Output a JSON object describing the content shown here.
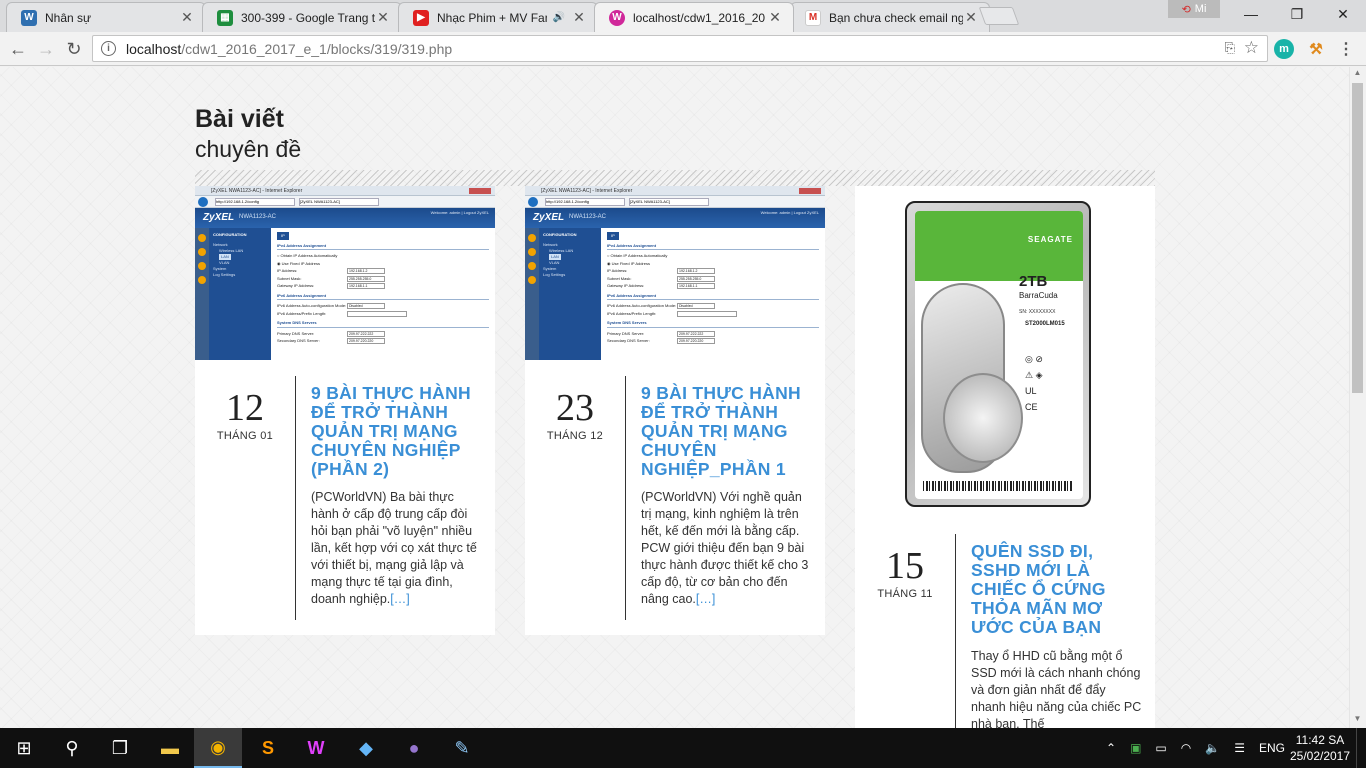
{
  "browser": {
    "tabs": [
      {
        "title": "Nhân sự",
        "favicon_color": "#2f6fb0",
        "favicon_glyph": "W",
        "active": false
      },
      {
        "title": "300-399 - Google Trang t",
        "favicon_color": "#1e8e3e",
        "favicon_glyph": "▦",
        "active": false
      },
      {
        "title": "Nhạc Phim + MV Fan",
        "favicon_color": "#e02020",
        "favicon_glyph": "▶",
        "active": false,
        "audio": true
      },
      {
        "title": "localhost/cdw1_2016_20",
        "favicon_color": "#d0289a",
        "favicon_glyph": "W",
        "active": true
      },
      {
        "title": "Bạn chưa check email ng",
        "favicon_color": "#ffffff",
        "favicon_glyph": "M",
        "active": false
      }
    ],
    "profile_label": "Mi",
    "url_host": "localhost",
    "url_path": "/cdw1_2016_2017_e_1/blocks/319/319.php",
    "extensions": [
      {
        "glyph": "m",
        "color": "#18b3a8"
      },
      {
        "glyph": "⚒",
        "color": "#e08a1e"
      }
    ]
  },
  "page": {
    "heading_bold": "Bài viết",
    "heading_sub": "chuyên đề",
    "posts": [
      {
        "day": "12",
        "month": "THÁNG 01",
        "title": "9 BÀI THỰC HÀNH ĐỂ TRỞ THÀNH QUẢN TRỊ MẠNG CHUYÊN NGHIỆP (PHẦN 2)",
        "excerpt": "(PCWorldVN) Ba bài thực hành ở cấp độ trung cấp đòi hỏi bạn phải \"võ luyện\" nhiều lần, kết hợp với cọ xát thực tế với thiết bị, mạng giả lập và mạng thực tế tại gia đình, doanh nghiệp.",
        "more": "[…]"
      },
      {
        "day": "23",
        "month": "THÁNG 12",
        "title": "9 BÀI THỰC HÀNH ĐỂ TRỞ THÀNH QUẢN TRỊ MẠNG CHUYÊN NGHIỆP_PHẦN 1",
        "excerpt": "(PCWorldVN) Với nghề quản trị mạng, kinh nghiệm là trên hết, kế đến mới là bằng cấp. PCW giới thiệu đến bạn 9 bài thực hành được thiết kế cho 3 cấp độ, từ cơ bản cho đến nâng cao.",
        "more": "[…]"
      },
      {
        "day": "15",
        "month": "THÁNG 11",
        "title": "QUÊN SSD ĐI, SSHD MỚI LÀ CHIẾC Ổ CỨNG THỎA MÃN MƠ ƯỚC CỦA BẠN",
        "excerpt": "Thay ổ HHD cũ bằng một ổ SSD mới là cách nhanh chóng và đơn giản nhất để đẩy nhanh hiệu năng của chiếc PC nhà bạn. Thế",
        "more": ""
      }
    ],
    "screenshot": {
      "window_title": "[ZyXEL NWA1123-AC] - Internet Explorer",
      "address": "http://192.168.1.2/config",
      "tab_label": "[ZyXEL NWA1123-AC]",
      "logo": "ZyXEL",
      "model": "NWA1123-AC",
      "top_right": "Welcome: admin | Logout   ZyXEL",
      "nav_header": "CONFIGURATION",
      "nav_items": [
        "Network",
        "Wireless LAN",
        "LAN",
        "VLAN",
        "System",
        "Log Settings"
      ],
      "tab_ip": "IP",
      "sec_ipv4": "IPv4 Address Assignment",
      "opt_obtain": "○ Obtain IP Address Automatically",
      "opt_fixed": "◉ Use Fixed IP Address",
      "lbl_ip": "IP Address:",
      "val_ip": "192.168.1.2",
      "lbl_subnet": "Subnet Mask:",
      "val_subnet": "255.255.255.0",
      "lbl_gateway": "Gateway IP Address:",
      "val_gateway": "192.168.1.1",
      "sec_ipv6": "IPv6 Address Assignment",
      "lbl_v6auto": "IPv6 Address Auto-configuration Mode:",
      "val_v6auto": "Disabled",
      "lbl_v6prefix": "IPv6 Address/Prefix Length:",
      "sec_dns": "System DNS Servers",
      "lbl_dns1": "Primary DNS Server:",
      "val_dns1": "209.97.222.222",
      "lbl_dns2": "Secondary DNS Server:",
      "val_dns2": "209.97.220.220"
    },
    "hdd": {
      "brand": "SEAGATE",
      "capacity": "2TB",
      "line": "BarraCuda",
      "sn": "SN: XXXXXXXX",
      "model": "ST2000LM015",
      "certs": "◎ ⊘\n⚠ ◈\nUL\nCE"
    }
  },
  "taskbar": {
    "items": [
      {
        "icon": "start-icon",
        "glyph": "⊞"
      },
      {
        "icon": "search-icon",
        "glyph": "⚲"
      },
      {
        "icon": "task-view-icon",
        "glyph": "❐"
      },
      {
        "icon": "file-explorer-icon",
        "glyph": "▬"
      },
      {
        "icon": "chrome-icon",
        "glyph": "◉",
        "active": true
      },
      {
        "icon": "sublime-text-icon",
        "glyph": "S"
      },
      {
        "icon": "webstorm-icon",
        "glyph": "W"
      },
      {
        "icon": "virtualbox-icon",
        "glyph": "◆"
      },
      {
        "icon": "app-icon",
        "glyph": "●"
      },
      {
        "icon": "paint-icon",
        "glyph": "✎"
      }
    ],
    "lang": "ENG",
    "time": "11:42 SA",
    "date": "25/02/2017"
  }
}
